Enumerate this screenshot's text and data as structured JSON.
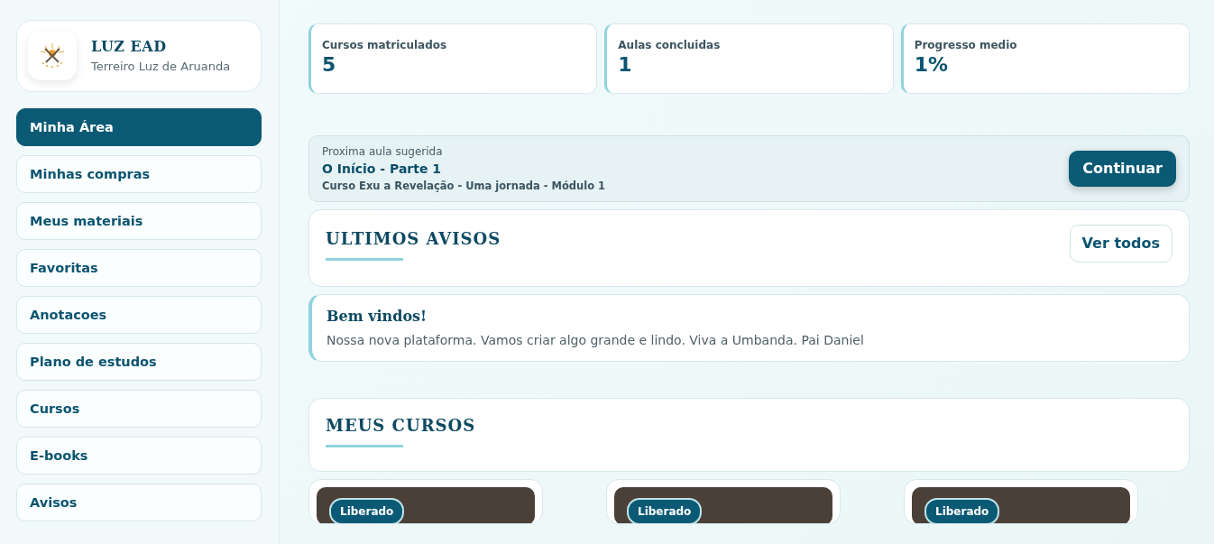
{
  "brand": {
    "title": "LUZ EAD",
    "subtitle": "Terreiro Luz de Aruanda"
  },
  "sidebar": {
    "items": [
      {
        "label": "Minha Área",
        "selected": true
      },
      {
        "label": "Minhas compras",
        "selected": false
      },
      {
        "label": "Meus materiais",
        "selected": false
      },
      {
        "label": "Favoritas",
        "selected": false
      },
      {
        "label": "Anotacoes",
        "selected": false
      },
      {
        "label": "Plano de estudos",
        "selected": false
      },
      {
        "label": "Cursos",
        "selected": false
      },
      {
        "label": "E-books",
        "selected": false
      },
      {
        "label": "Avisos",
        "selected": false
      }
    ]
  },
  "stats": [
    {
      "label": "Cursos matriculados",
      "value": "5"
    },
    {
      "label": "Aulas concluidas",
      "value": "1"
    },
    {
      "label": "Progresso medio",
      "value": "1%"
    }
  ],
  "next_lesson": {
    "caption": "Proxima aula sugerida",
    "title": "O Início - Parte 1",
    "course": "Curso Exu a Revelação - Uma jornada - Módulo 1",
    "button": "Continuar"
  },
  "notices": {
    "title": "ULTIMOS AVISOS",
    "button": "Ver todos",
    "items": [
      {
        "title": "Bem vindos!",
        "text": "Nossa nova plataforma. Vamos criar algo grande e lindo. Viva a Umbanda. Pai Daniel"
      }
    ]
  },
  "courses": {
    "title": "MEUS CURSOS",
    "items": [
      {
        "badge": "Liberado"
      },
      {
        "badge": "Liberado"
      },
      {
        "badge": "Liberado"
      }
    ]
  }
}
